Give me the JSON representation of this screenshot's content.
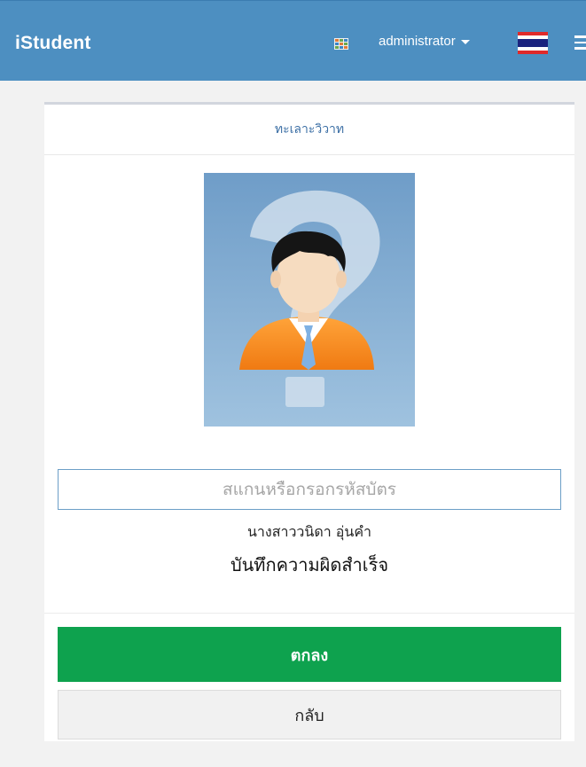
{
  "navbar": {
    "brand": "iStudent",
    "user_label": "administrator",
    "apps_icon": "grid-apps-icon",
    "flag_icon": "thai-flag-icon",
    "menu_icon": "hamburger-menu-icon"
  },
  "panel": {
    "title": "ทะเลาะวิวาท",
    "photo_icon": "unknown-person-question-icon"
  },
  "scan": {
    "placeholder": "สแกนหรือกรอกรหัสบัตร",
    "value": ""
  },
  "student": {
    "name": "นางสาววนิดา อุ่นคำ"
  },
  "status": {
    "message": "บันทึกความผิดสำเร็จ"
  },
  "buttons": {
    "ok_label": "ตกลง",
    "back_label": "กลับ"
  },
  "colors": {
    "navbar": "#4d8fc1",
    "ok_button": "#0ea24e",
    "title_text": "#3c6fa5"
  }
}
